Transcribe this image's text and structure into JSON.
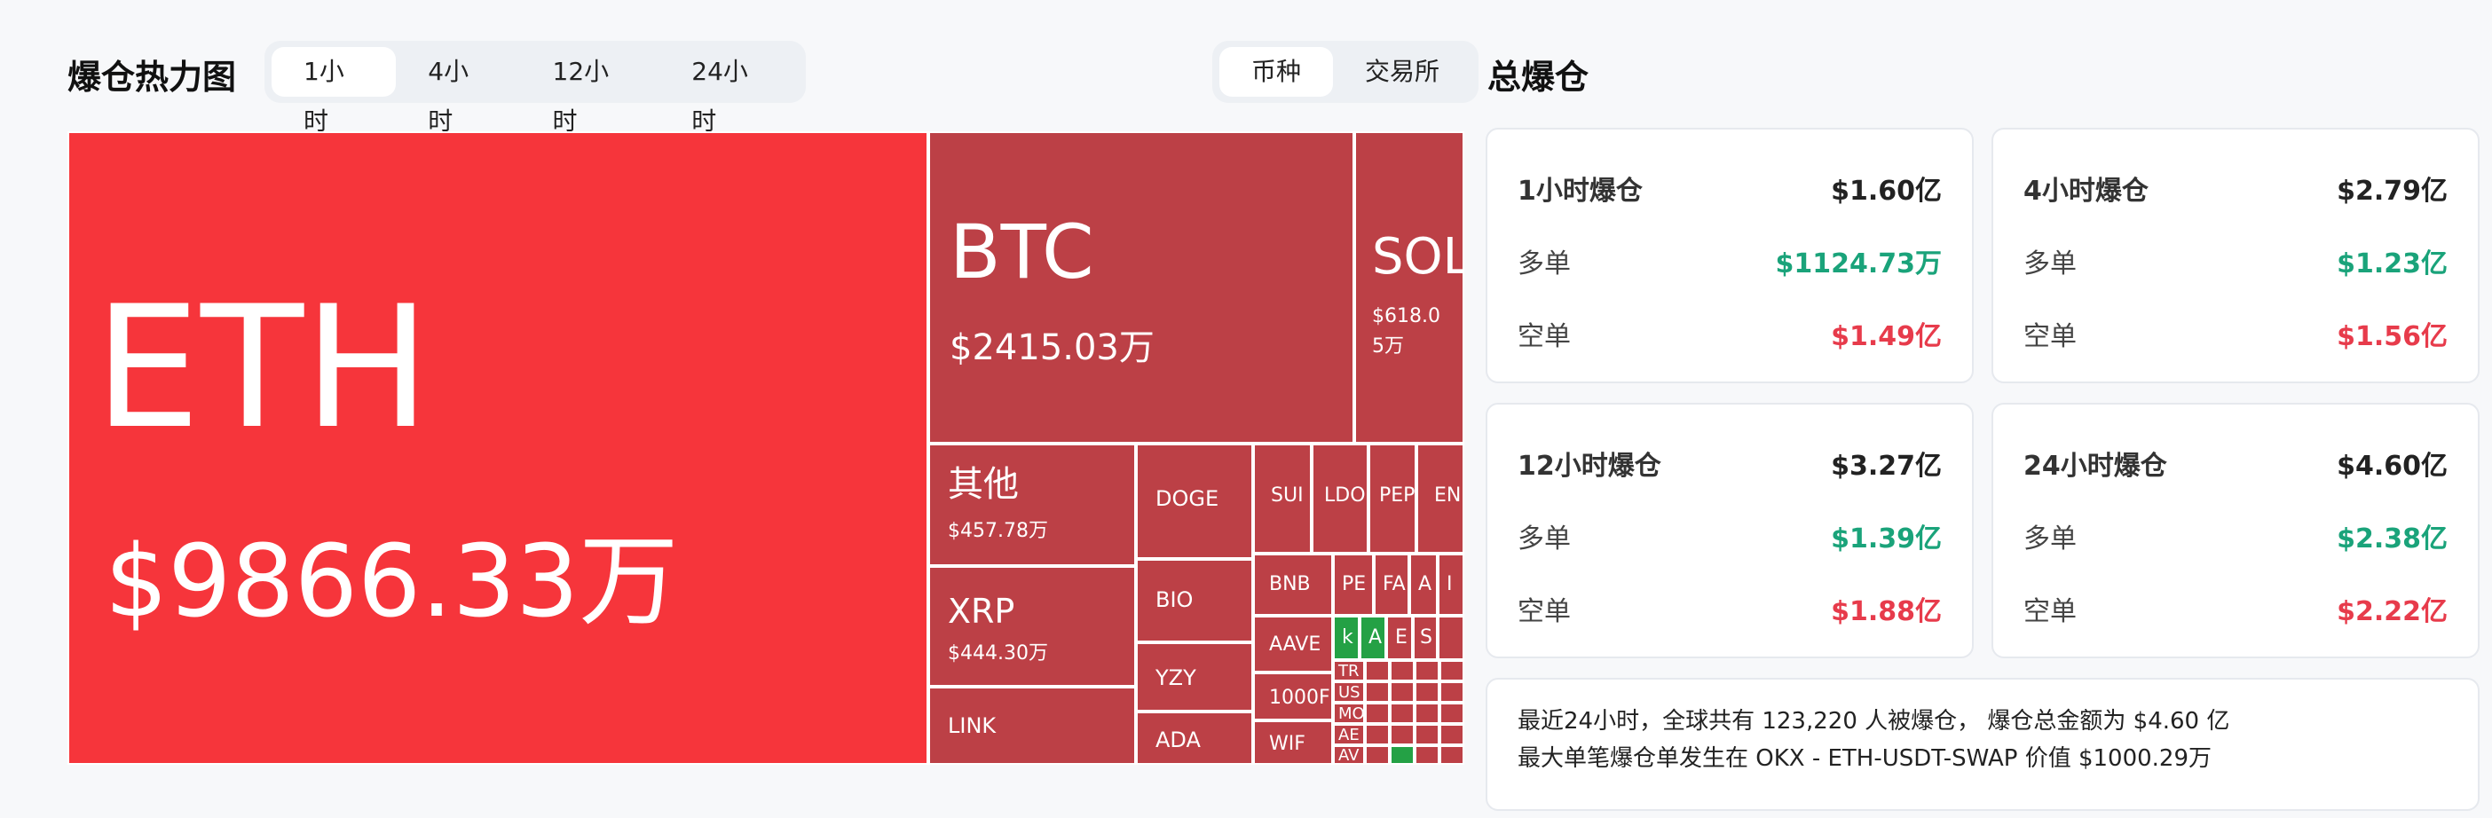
{
  "left_header": {
    "title": "爆仓热力图",
    "time_tabs": [
      "1小时",
      "4小时",
      "12小时",
      "24小时"
    ],
    "active_time_tab": "1小时",
    "view_tabs": [
      "币种",
      "交易所"
    ],
    "active_view_tab": "币种"
  },
  "heatmap": {
    "tiles": [
      {
        "symbol": "ETH",
        "amount": "$9866.33万"
      },
      {
        "symbol": "BTC",
        "amount": "$2415.03万"
      },
      {
        "symbol": "SOL",
        "amount": "$618.05万"
      },
      {
        "symbol": "其他",
        "amount": "$457.78万"
      },
      {
        "symbol": "XRP",
        "amount": "$444.30万"
      },
      {
        "symbol": "LINK",
        "amount": ""
      },
      {
        "symbol": "DOGE",
        "amount": ""
      },
      {
        "symbol": "BIO",
        "amount": ""
      },
      {
        "symbol": "YZY",
        "amount": ""
      },
      {
        "symbol": "ADA",
        "amount": ""
      },
      {
        "symbol": "SUI",
        "amount": ""
      },
      {
        "symbol": "LDO",
        "amount": ""
      },
      {
        "symbol": "PEP",
        "amount": ""
      },
      {
        "symbol": "EN",
        "amount": ""
      },
      {
        "symbol": "BNB",
        "amount": ""
      },
      {
        "symbol": "PE",
        "amount": ""
      },
      {
        "symbol": "FA",
        "amount": ""
      },
      {
        "symbol": "A",
        "amount": ""
      },
      {
        "symbol": "I",
        "amount": ""
      },
      {
        "symbol": "AAVE",
        "amount": ""
      },
      {
        "symbol": "k",
        "amount": ""
      },
      {
        "symbol": "A",
        "amount": ""
      },
      {
        "symbol": "E",
        "amount": ""
      },
      {
        "symbol": "S",
        "amount": ""
      },
      {
        "symbol": "1000F",
        "amount": ""
      },
      {
        "symbol": "TR",
        "amount": ""
      },
      {
        "symbol": "US",
        "amount": ""
      },
      {
        "symbol": "MO",
        "amount": ""
      },
      {
        "symbol": "AE",
        "amount": ""
      },
      {
        "symbol": "AV",
        "amount": ""
      },
      {
        "symbol": "WIF",
        "amount": ""
      }
    ]
  },
  "right_header": {
    "title": "总爆仓"
  },
  "cards": [
    {
      "title": "1小时爆仓",
      "total": "$1.60亿",
      "long_label": "多单",
      "long_value": "$1124.73万",
      "short_label": "空单",
      "short_value": "$1.49亿"
    },
    {
      "title": "4小时爆仓",
      "total": "$2.79亿",
      "long_label": "多单",
      "long_value": "$1.23亿",
      "short_label": "空单",
      "short_value": "$1.56亿"
    },
    {
      "title": "12小时爆仓",
      "total": "$3.27亿",
      "long_label": "多单",
      "long_value": "$1.39亿",
      "short_label": "空单",
      "short_value": "$1.88亿"
    },
    {
      "title": "24小时爆仓",
      "total": "$4.60亿",
      "long_label": "多单",
      "long_value": "$2.38亿",
      "short_label": "空单",
      "short_value": "$2.22亿"
    }
  ],
  "summary": {
    "line1": "最近24小时，全球共有 123,220 人被爆仓， 爆仓总金额为 $4.60 亿",
    "line2": "最大单笔爆仓单发生在 OKX - ETH-USDT-SWAP 价值 $1000.29万"
  },
  "colors": {
    "eth_tile": "#f6353b",
    "short_tile": "#bc4046",
    "long_tile": "#24a145",
    "long_text": "#1aa37a",
    "short_text": "#e73b4b"
  }
}
